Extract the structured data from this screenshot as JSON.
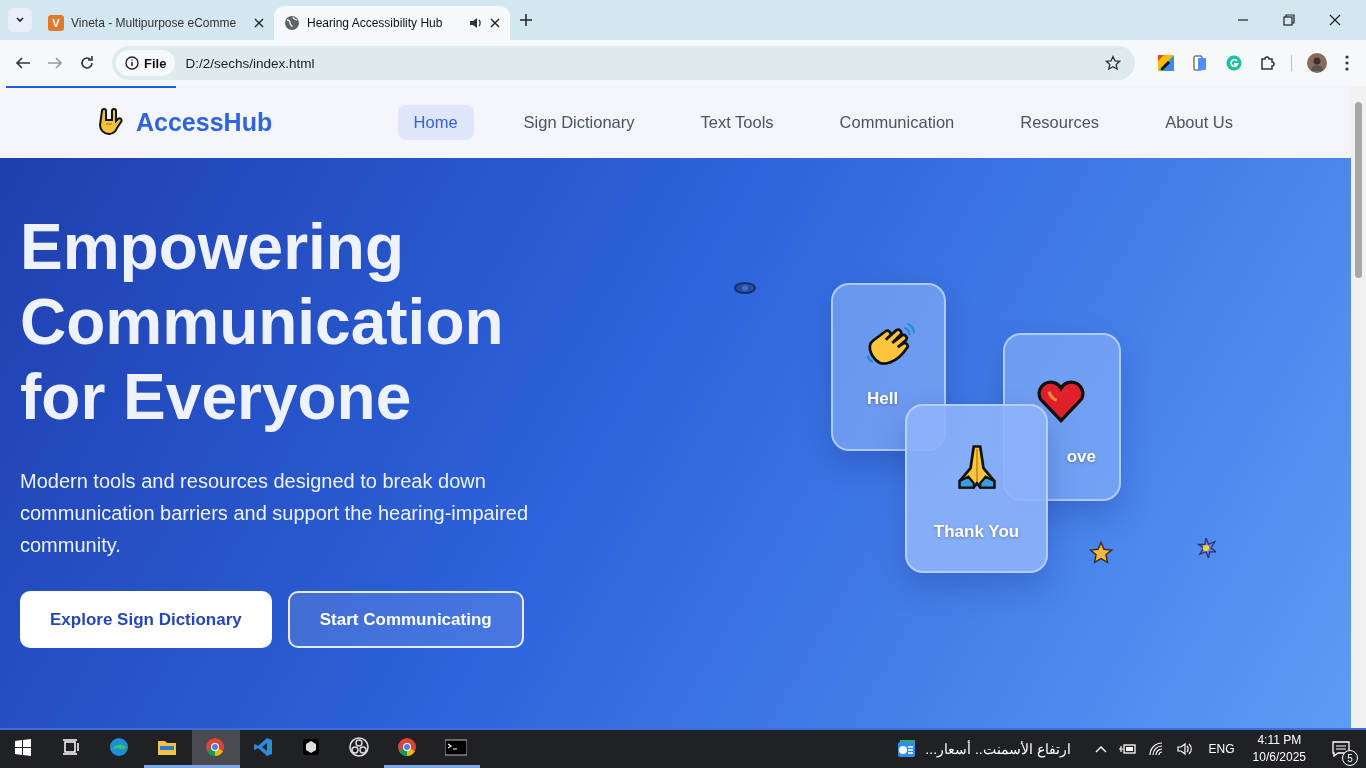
{
  "browser": {
    "tabs": [
      {
        "title": "Vineta - Multipurpose eComme",
        "kind": "letter",
        "icon_text": "V",
        "selected": false,
        "audio": false
      },
      {
        "title": "Hearing Accessibility Hub",
        "kind": "globe",
        "selected": true,
        "audio": true
      }
    ],
    "address": {
      "badge": "File",
      "url": "D:/2/sechs/index.html"
    }
  },
  "page": {
    "brand": "AccessHub",
    "nav": [
      {
        "label": "Home",
        "selected": true
      },
      {
        "label": "Sign Dictionary",
        "selected": false
      },
      {
        "label": "Text Tools",
        "selected": false
      },
      {
        "label": "Communication",
        "selected": false
      },
      {
        "label": "Resources",
        "selected": false
      },
      {
        "label": "About Us",
        "selected": false
      }
    ],
    "hero": {
      "heading": "Empowering Communication for Everyone",
      "subtitle": "Modern tools and resources designed to break down communication barriers and support the hearing-impaired community.",
      "buttons": [
        {
          "label": "Explore Sign Dictionary",
          "kind": "primary"
        },
        {
          "label": "Start Communicating",
          "kind": "outline"
        }
      ],
      "cards": [
        {
          "label": "Hell",
          "kind": "wave"
        },
        {
          "label": "ove",
          "kind": "heart"
        },
        {
          "label": "Thank You",
          "kind": "pray"
        }
      ]
    }
  },
  "taskbar": {
    "apps": [
      {
        "kind": "start",
        "open": false,
        "selected": false
      },
      {
        "kind": "taskview",
        "open": false,
        "selected": false
      },
      {
        "kind": "edge",
        "open": false,
        "selected": false
      },
      {
        "kind": "folder",
        "open": true,
        "selected": false
      },
      {
        "kind": "chrome",
        "open": true,
        "selected": true
      },
      {
        "kind": "code",
        "open": false,
        "selected": false
      },
      {
        "kind": "cube",
        "open": false,
        "selected": false
      },
      {
        "kind": "obs",
        "open": false,
        "selected": false
      },
      {
        "kind": "chrome",
        "open": true,
        "selected": false
      },
      {
        "kind": "terminal",
        "open": true,
        "selected": false
      }
    ],
    "news": "ارتفاع الأسمنت.. أسعار...",
    "lang": "ENG",
    "time": "4:11 PM",
    "date": "10/6/2025",
    "notifications": "5"
  }
}
